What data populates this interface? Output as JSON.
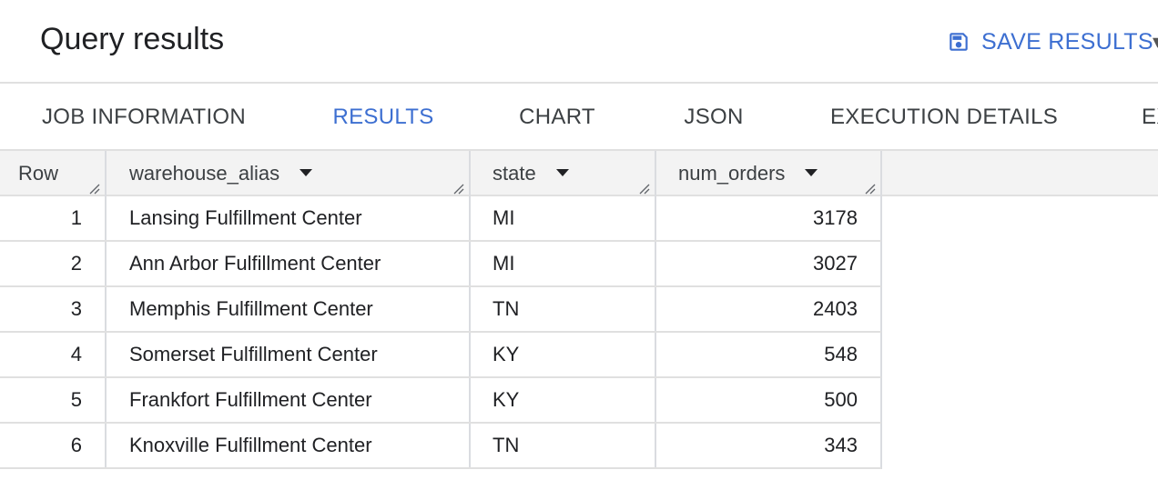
{
  "header": {
    "title": "Query results",
    "save_label": "SAVE RESULTS",
    "save_icon": "save-icon"
  },
  "tabs": [
    {
      "label": "JOB INFORMATION",
      "active": false
    },
    {
      "label": "RESULTS",
      "active": true
    },
    {
      "label": "CHART",
      "active": false
    },
    {
      "label": "JSON",
      "active": false
    },
    {
      "label": "EXECUTION DETAILS",
      "active": false
    },
    {
      "label": "EX",
      "active": false
    }
  ],
  "table": {
    "columns": [
      "Row",
      "warehouse_alias",
      "state",
      "num_orders"
    ],
    "rows": [
      {
        "row": "1",
        "warehouse_alias": "Lansing Fulfillment Center",
        "state": "MI",
        "num_orders": "3178"
      },
      {
        "row": "2",
        "warehouse_alias": "Ann Arbor Fulfillment Center",
        "state": "MI",
        "num_orders": "3027"
      },
      {
        "row": "3",
        "warehouse_alias": "Memphis Fulfillment Center",
        "state": "TN",
        "num_orders": "2403"
      },
      {
        "row": "4",
        "warehouse_alias": "Somerset Fulfillment Center",
        "state": "KY",
        "num_orders": "548"
      },
      {
        "row": "5",
        "warehouse_alias": "Frankfort Fulfillment Center",
        "state": "KY",
        "num_orders": "500"
      },
      {
        "row": "6",
        "warehouse_alias": "Knoxville Fulfillment Center",
        "state": "TN",
        "num_orders": "343"
      }
    ]
  },
  "colors": {
    "accent": "#3d6fd1",
    "header_bg": "#f3f3f3",
    "border": "#e0e0e0"
  }
}
